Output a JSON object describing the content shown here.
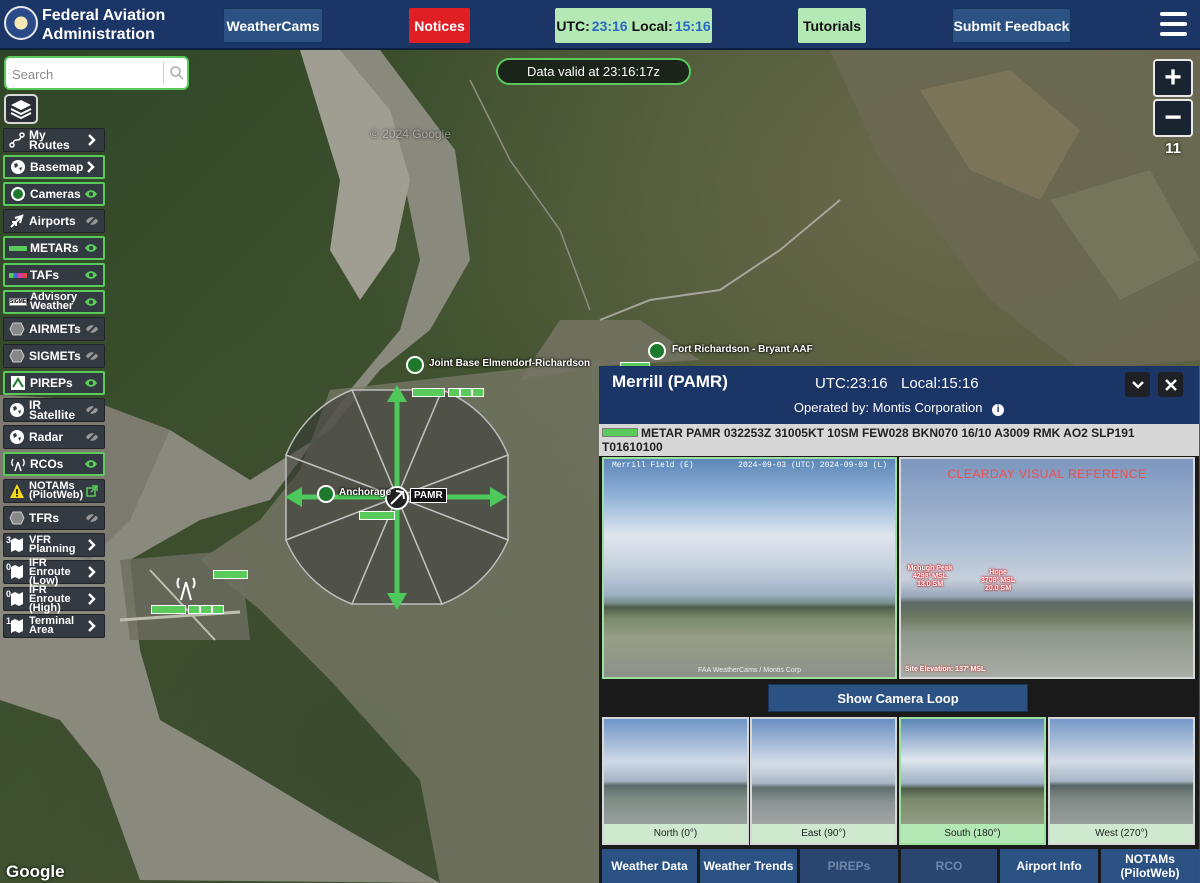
{
  "header": {
    "brand_line1": "Federal Aviation",
    "brand_line2": "Administration",
    "weathercams_label": "WeatherCams",
    "notices_label": "Notices",
    "utc_label": "UTC:",
    "utc_time": "23:16",
    "local_label": "Local:",
    "local_time": "15:16",
    "tutorials_label": "Tutorials",
    "feedback_label": "Submit Feedback",
    "colors": {
      "header_bg": "#1b3566",
      "notices": "#e01f25",
      "accent_green": "#b4e8b4",
      "time_blue": "#2a68c4"
    }
  },
  "search": {
    "placeholder": "Search",
    "value": ""
  },
  "map": {
    "data_valid": "Data valid at 23:16:17z",
    "zoom_level": "11",
    "zoom_in": "+",
    "zoom_out": "−",
    "labels": {
      "jber": "Joint Base Elmendorf-Richardson",
      "fort_richardson": "Fort Richardson - Bryant AAF",
      "anchorage": "Anchorage",
      "pamr": "PAMR"
    },
    "watermark": "© 2024 Google",
    "google": "Google"
  },
  "layers": [
    {
      "label": "My Routes",
      "icon": "route-icon",
      "trailing": "chevron",
      "on": false
    },
    {
      "label": "Basemap",
      "icon": "globe-icon",
      "trailing": "chevron",
      "on": true
    },
    {
      "label": "Cameras",
      "icon": "camera-dot-icon",
      "trailing": "eye",
      "on": true
    },
    {
      "label": "Airports",
      "icon": "airplane-icon",
      "trailing": "eye-off",
      "on": false
    },
    {
      "label": "METARs",
      "icon": "metar-bar-icon",
      "trailing": "eye",
      "on": true
    },
    {
      "label": "TAFs",
      "icon": "taf-bar-icon",
      "trailing": "eye",
      "on": true
    },
    {
      "label_line1": "Advisory",
      "label_line2": "Weather",
      "icon": "advisory-icon",
      "trailing": "eye",
      "on": true
    },
    {
      "label": "AIRMETs",
      "icon": "hexagon-icon",
      "trailing": "eye-off",
      "on": false
    },
    {
      "label": "SIGMETs",
      "icon": "hexagon-icon",
      "trailing": "eye-off",
      "on": false
    },
    {
      "label": "PIREPs",
      "icon": "pirep-icon",
      "trailing": "eye",
      "on": true
    },
    {
      "label": "IR Satellite",
      "icon": "globe-icon",
      "trailing": "eye-off",
      "on": false
    },
    {
      "label": "Radar",
      "icon": "globe-icon",
      "trailing": "eye-off",
      "on": false
    },
    {
      "label": "RCOs",
      "icon": "antenna-icon",
      "trailing": "eye",
      "on": true
    },
    {
      "label_line1": "NOTAMs",
      "label_line2": "(PilotWeb)",
      "icon": "warning-icon",
      "trailing": "external-link",
      "on": false
    },
    {
      "label": "TFRs",
      "icon": "hexagon-icon",
      "trailing": "eye-off",
      "on": false
    },
    {
      "label_line1": "VFR",
      "label_line2": "Planning",
      "icon": "chart-icon",
      "trailing": "chevron",
      "on": false,
      "num": "3"
    },
    {
      "label_line1": "IFR Enroute",
      "label_line2": "(Low)",
      "icon": "chart-icon",
      "trailing": "chevron",
      "on": false,
      "num": "0"
    },
    {
      "label_line1": "IFR Enroute",
      "label_line2": "(High)",
      "icon": "chart-icon",
      "trailing": "chevron",
      "on": false,
      "num": "0"
    },
    {
      "label_line1": "Terminal",
      "label_line2": "Area",
      "icon": "chart-icon",
      "trailing": "chevron",
      "on": false,
      "num": "1"
    }
  ],
  "panel": {
    "station": "Merrill (PAMR)",
    "utc": "UTC:23:16",
    "local": "Local:15:16",
    "operator": "Operated by: Montis Corporation",
    "metar": "METAR PAMR 032253Z 31005KT 10SM FEW028 BKN070 16/10 A3009 RMK AO2 SLP191 T01610100",
    "cam_main_header_left": "Merrill Field (E)",
    "cam_main_header_right": "2024-09-03 (UTC)     2024-09-03 (L)",
    "cam_main_footer": "FAA WeatherCams / Montis Corp",
    "cam_ref_title": "CLEARDAY VISUAL REFERENCE",
    "peaks": [
      {
        "name": "Mchugh Peak",
        "alt": "4298' MSL",
        "dist": "13.0 SM"
      },
      {
        "name": "Hope",
        "alt": "3708' MSL",
        "dist": "20.0 SM"
      }
    ],
    "site_elevation": "Site Elevation: 137' MSL",
    "loop_label": "Show Camera Loop",
    "thumbnails": [
      {
        "caption": "North (0°)",
        "selected": false
      },
      {
        "caption": "East (90°)",
        "selected": false
      },
      {
        "caption": "South (180°)",
        "selected": true
      },
      {
        "caption": "West (270°)",
        "selected": false
      }
    ],
    "tabs": [
      {
        "label": "Weather Data",
        "enabled": true
      },
      {
        "label": "Weather Trends",
        "enabled": true
      },
      {
        "label": "PIREPs",
        "enabled": false
      },
      {
        "label": "RCO",
        "enabled": false
      },
      {
        "label": "Airport Info",
        "enabled": true
      },
      {
        "label_line1": "NOTAMs",
        "label_line2": "(PilotWeb)",
        "enabled": true
      }
    ]
  }
}
